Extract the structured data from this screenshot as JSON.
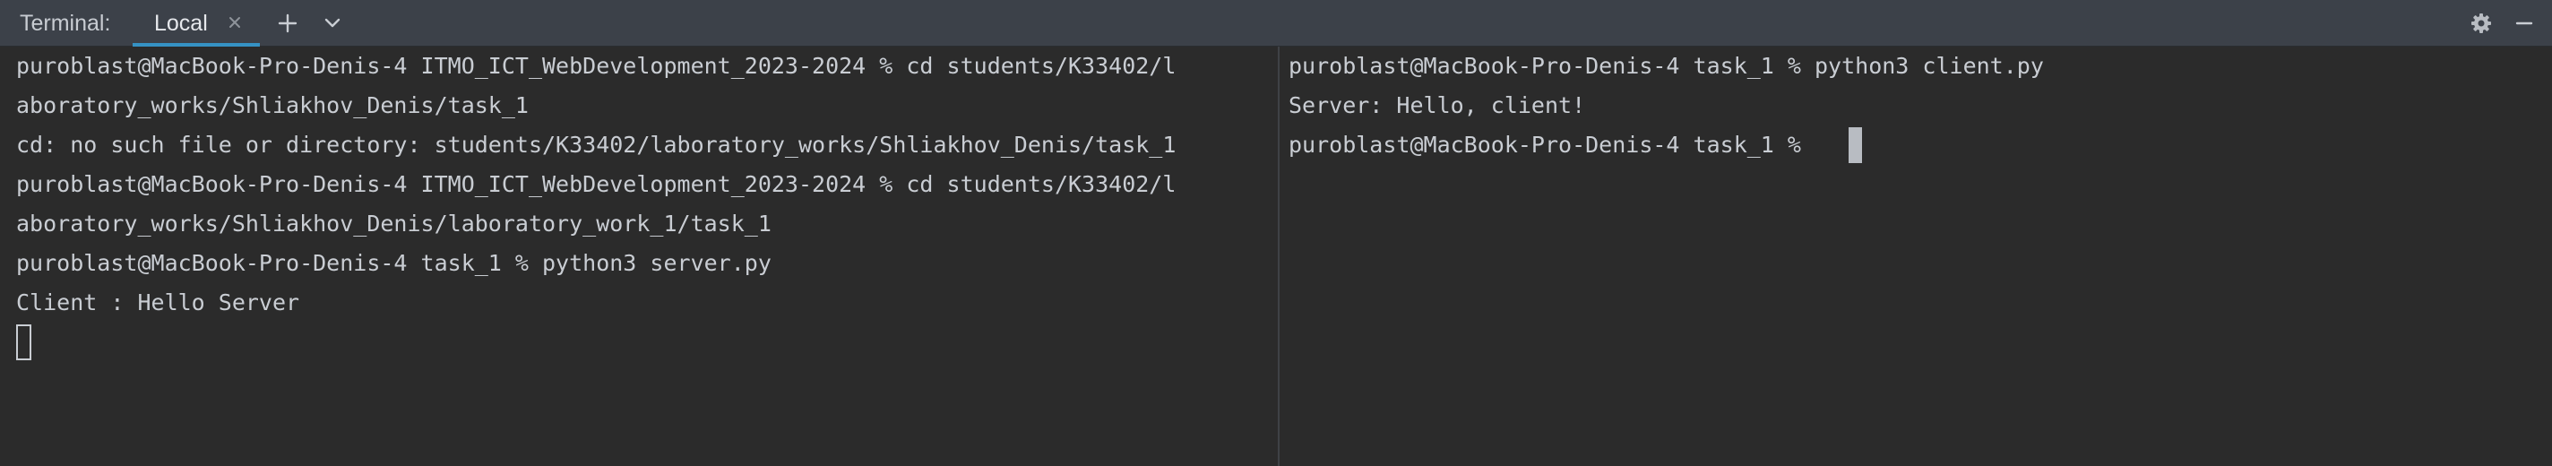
{
  "toolbar": {
    "title": "Terminal:",
    "tab_label": "Local",
    "add_icon": "plus-icon",
    "dropdown_icon": "chevron-down-icon",
    "settings_icon": "gear-icon",
    "minimize_icon": "minus-icon"
  },
  "left_pane": {
    "lines": [
      "puroblast@MacBook-Pro-Denis-4 ITMO_ICT_WebDevelopment_2023-2024 % cd students/K33402/l",
      "aboratory_works/Shliakhov_Denis/task_1",
      "cd: no such file or directory: students/K33402/laboratory_works/Shliakhov_Denis/task_1",
      "puroblast@MacBook-Pro-Denis-4 ITMO_ICT_WebDevelopment_2023-2024 % cd students/K33402/l",
      "aboratory_works/Shliakhov_Denis/laboratory_work_1/task_1",
      "puroblast@MacBook-Pro-Denis-4 task_1 % python3 server.py",
      "Client : Hello Server"
    ]
  },
  "right_pane": {
    "lines": [
      "puroblast@MacBook-Pro-Denis-4 task_1 % python3 client.py",
      "Server: Hello, client!",
      "puroblast@MacBook-Pro-Denis-4 task_1 % "
    ]
  },
  "colors": {
    "background": "#2b2b2b",
    "toolbar": "#3c4149",
    "text": "#c9cdd3",
    "tab_underline": "#3592c4"
  }
}
